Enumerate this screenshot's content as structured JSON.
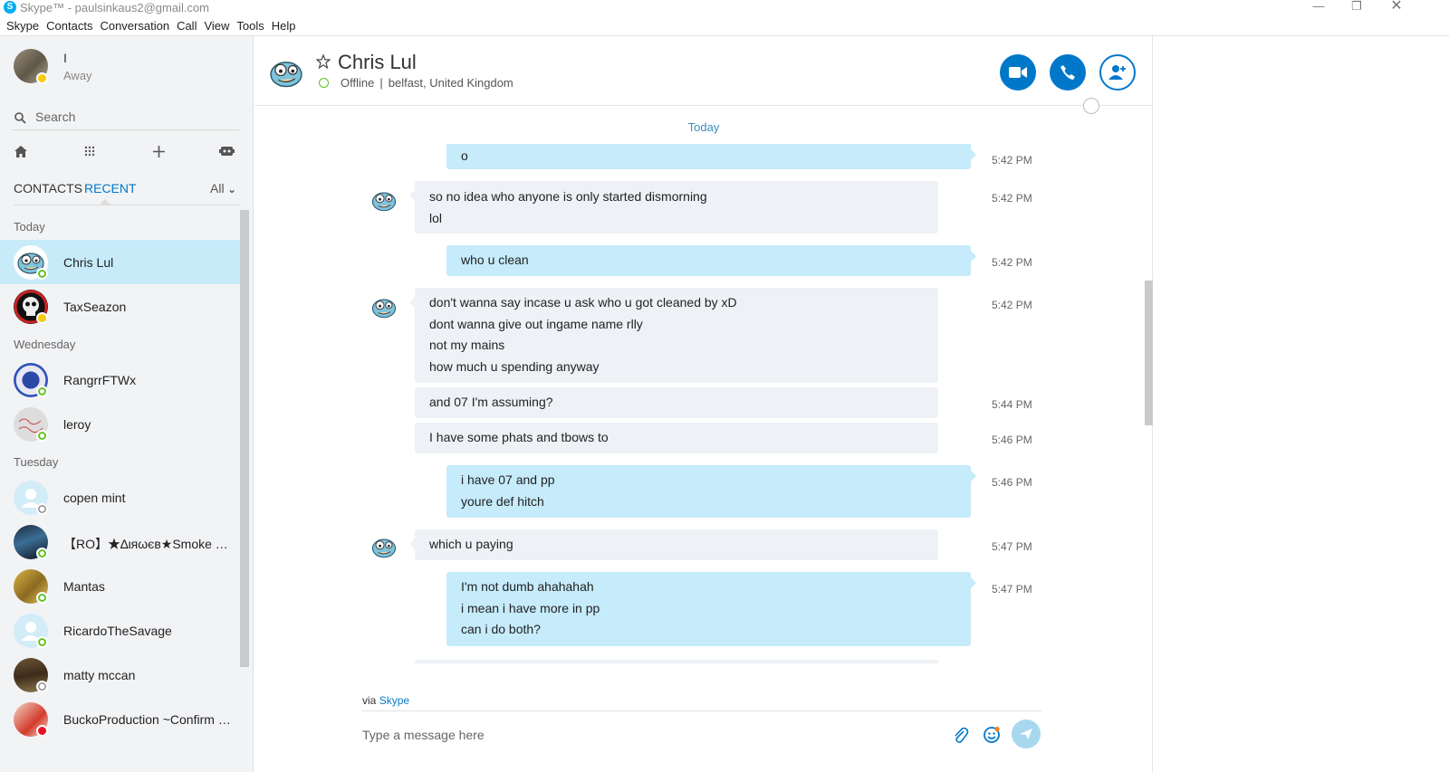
{
  "window": {
    "title": "Skype™ - paulsinkaus2@gmail.com"
  },
  "menu": [
    "Skype",
    "Contacts",
    "Conversation",
    "Call",
    "View",
    "Tools",
    "Help"
  ],
  "me": {
    "name": "I",
    "status": "Away"
  },
  "search": {
    "placeholder": "Search"
  },
  "tabs": {
    "contacts": "CONTACTS",
    "recent": "RECENT",
    "filter": "All"
  },
  "groups": [
    {
      "label": "Today",
      "contacts": [
        {
          "name": "Chris Lul",
          "status": "online",
          "active": true,
          "avatar": "bird"
        },
        {
          "name": "TaxSeazon",
          "status": "away",
          "active": false,
          "avatar": "skull"
        }
      ]
    },
    {
      "label": "Wednesday",
      "contacts": [
        {
          "name": "RangrrFTWx",
          "status": "online",
          "active": false,
          "avatar": "badge"
        },
        {
          "name": "leroy",
          "status": "online",
          "active": false,
          "avatar": "sketch"
        }
      ]
    },
    {
      "label": "Tuesday",
      "contacts": [
        {
          "name": "copen mint",
          "status": "unknown",
          "active": false,
          "avatar": "default"
        },
        {
          "name": "【RO】★∆ιяωєв★Smoke Big【...",
          "status": "online",
          "active": false,
          "avatar": "dark"
        },
        {
          "name": "Mantas",
          "status": "online",
          "active": false,
          "avatar": "gold"
        },
        {
          "name": "RicardoTheSavage",
          "status": "online",
          "active": false,
          "avatar": "default"
        },
        {
          "name": "matty mccan",
          "status": "unknown",
          "active": false,
          "avatar": "brown"
        },
        {
          "name": "BuckoProduction ~Confirm vi...",
          "status": "dnd",
          "active": false,
          "avatar": "anime"
        }
      ]
    }
  ],
  "chat": {
    "name": "Chris Lul",
    "status": "Offline",
    "location": "belfast, United Kingdom",
    "day_label": "Today",
    "messages": [
      {
        "dir": "out",
        "lines": [
          "o"
        ],
        "time": "5:42 PM",
        "avatar": false
      },
      {
        "dir": "in",
        "lines": [
          "so no idea who anyone is only started dismorning",
          "lol"
        ],
        "time": "5:42 PM",
        "avatar": true
      },
      {
        "dir": "out",
        "lines": [
          "who u clean"
        ],
        "time": "5:42 PM",
        "avatar": false
      },
      {
        "dir": "in",
        "lines": [
          "don't wanna say incase u ask who u got cleaned by xD",
          "dont wanna give out ingame name rlly",
          "not my mains",
          "how much u spending anyway"
        ],
        "time": "5:42 PM",
        "avatar": true
      },
      {
        "dir": "in",
        "lines": [
          "and 07 I'm assuming?"
        ],
        "time": "5:44 PM",
        "avatar": false
      },
      {
        "dir": "in",
        "lines": [
          "I have some phats and tbows to"
        ],
        "time": "5:46 PM",
        "avatar": false
      },
      {
        "dir": "out",
        "lines": [
          "i have 07 and pp",
          "youre def hitch"
        ],
        "time": "5:46 PM",
        "avatar": false
      },
      {
        "dir": "in",
        "lines": [
          "which u paying"
        ],
        "time": "5:47 PM",
        "avatar": true
      },
      {
        "dir": "out",
        "lines": [
          "I'm not dumb ahahahah",
          "i mean i have more in pp",
          "can i do both?"
        ],
        "time": "5:47 PM",
        "avatar": false
      }
    ],
    "via_prefix": "via",
    "via_link": "Skype",
    "composer_placeholder": "Type a message here"
  },
  "colors": {
    "accent": "#0078ca",
    "out_bubble": "#c6ebfb",
    "in_bubble": "#eef1f5",
    "active_row": "#c8ebfa"
  }
}
